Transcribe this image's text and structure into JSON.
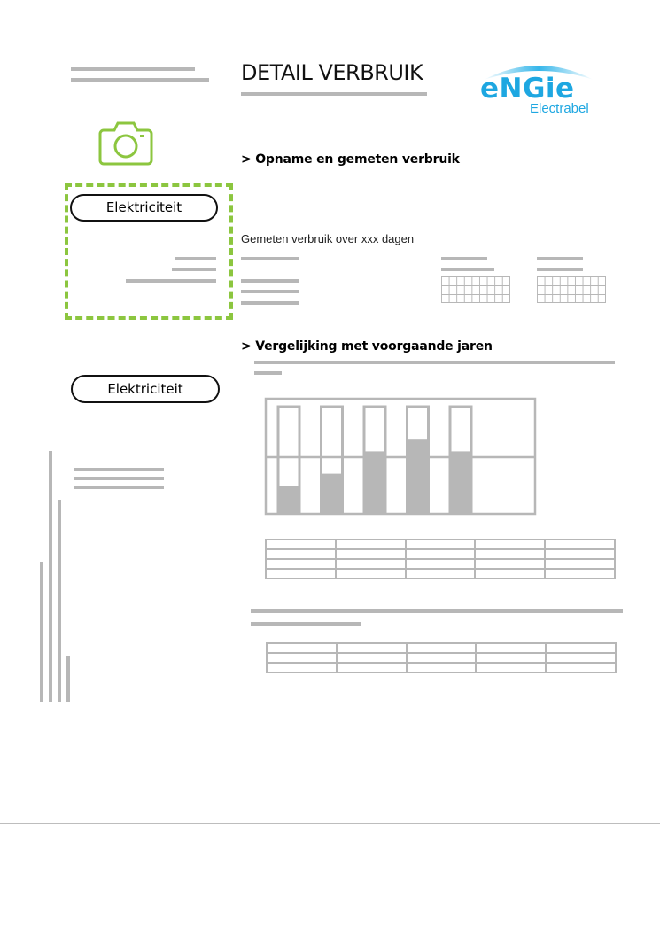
{
  "header": {
    "title": "DETAIL VERBRUIK",
    "logo_brand": "eNGie",
    "logo_sub": "Electrabel"
  },
  "colors": {
    "accent_green": "#8cc63f",
    "brand_blue": "#1ea7e1",
    "placeholder_gray": "#b7b7b7"
  },
  "icons": {
    "camera": "camera-icon"
  },
  "sections": {
    "reading": "> Opname en gemeten verbruik",
    "comparison": "> Vergelijking met voorgaande jaren"
  },
  "left": {
    "pill_1": "Elektriciteit",
    "pill_2": "Elektriciteit"
  },
  "measured_text": "Gemeten verbruik over xxx dagen",
  "chart_data": {
    "type": "bar",
    "bar_levels": [
      0.25,
      0.37,
      0.58,
      0.69,
      0.58
    ],
    "stacked_remaining": true
  }
}
